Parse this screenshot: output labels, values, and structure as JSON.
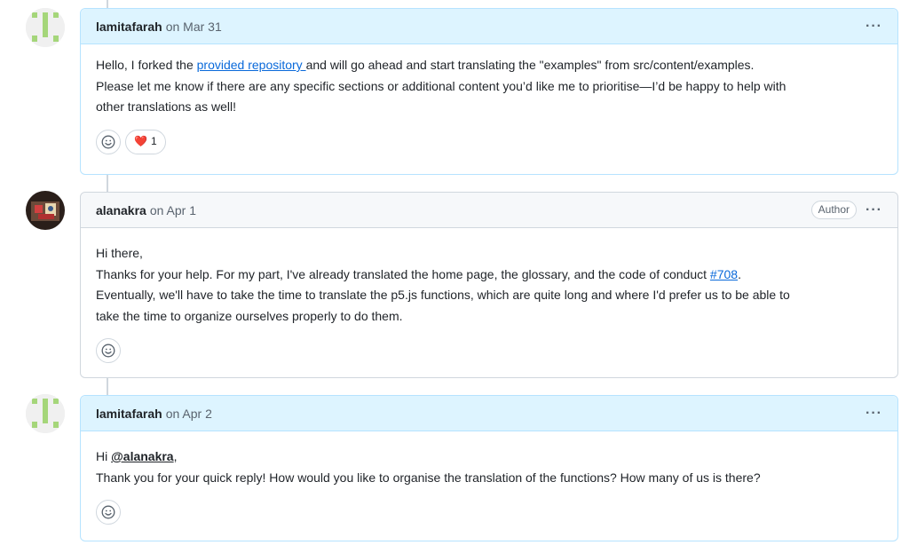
{
  "comments": [
    {
      "author": "lamitafarah",
      "date": "on Mar 31",
      "paragraphs": {
        "p1_pre": "Hello, I forked the ",
        "p1_link": "provided repository ",
        "p1_post": "and will go ahead and start translating the \"examples\" from src/content/examples.",
        "p2": "Please let me know if there are any specific sections or additional content you’d like me to prioritise—I’d be happy to help with",
        "p3": "other translations as well!"
      },
      "reaction": {
        "icon": "heart",
        "count": "1"
      }
    },
    {
      "author": "alanakra",
      "date": "on Apr 1",
      "badge": "Author",
      "paragraphs": {
        "p1": "Hi there,",
        "p2_pre": "Thanks for your help. For my part, I've already translated the home page, the glossary, and the code of conduct ",
        "p2_link": "#708",
        "p2_post": ".",
        "p3": "Eventually, we'll have to take the time to translate the p5.js functions, which are quite long and where I'd prefer us to be able to",
        "p4": "take the time to organize ourselves properly to do them."
      }
    },
    {
      "author": "lamitafarah",
      "date": "on Apr 2",
      "paragraphs": {
        "p1_pre": "Hi ",
        "p1_mention": "@alanakra",
        "p1_post": ",",
        "p2": "Thank you for your quick reply! How would you like to organise the translation of the functions? How many of us is there?"
      }
    }
  ],
  "menu_glyph": "···",
  "colors": {
    "accent": "#0969da",
    "own_header": "#ddf4ff",
    "own_border": "#b6e3ff",
    "heart": "#d1242f"
  },
  "icons": [
    "smiley-icon",
    "heart-icon",
    "kebab-icon"
  ]
}
